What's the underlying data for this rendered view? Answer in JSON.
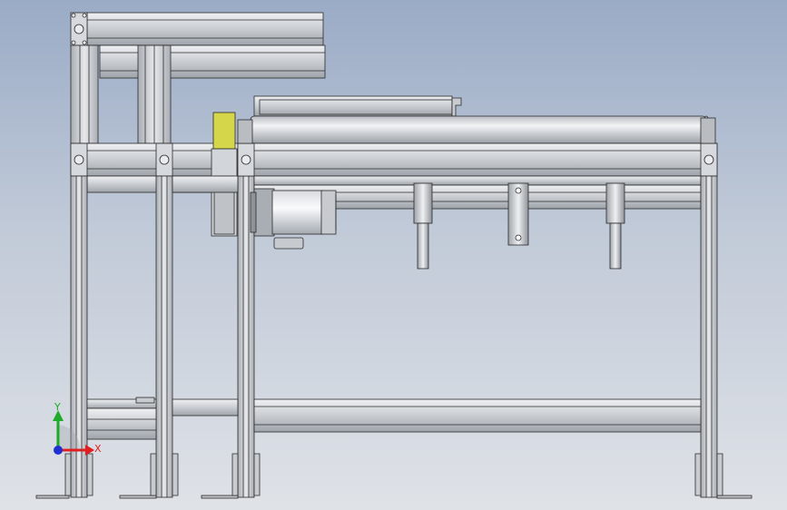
{
  "view": {
    "background_top": "#9aabc6",
    "background_bottom": "#dfe2e7"
  },
  "triad": {
    "x_label": "X",
    "y_label": "Y",
    "x_color": "#e02020",
    "y_color": "#1faa2a",
    "z_color": "#2030d0"
  },
  "colors": {
    "profile": "#cfd3d8",
    "profile_dark": "#9ca2a9",
    "edge": "#2a2a2a",
    "sensor": "#d8d84a",
    "motor": "#c9ccd1"
  }
}
